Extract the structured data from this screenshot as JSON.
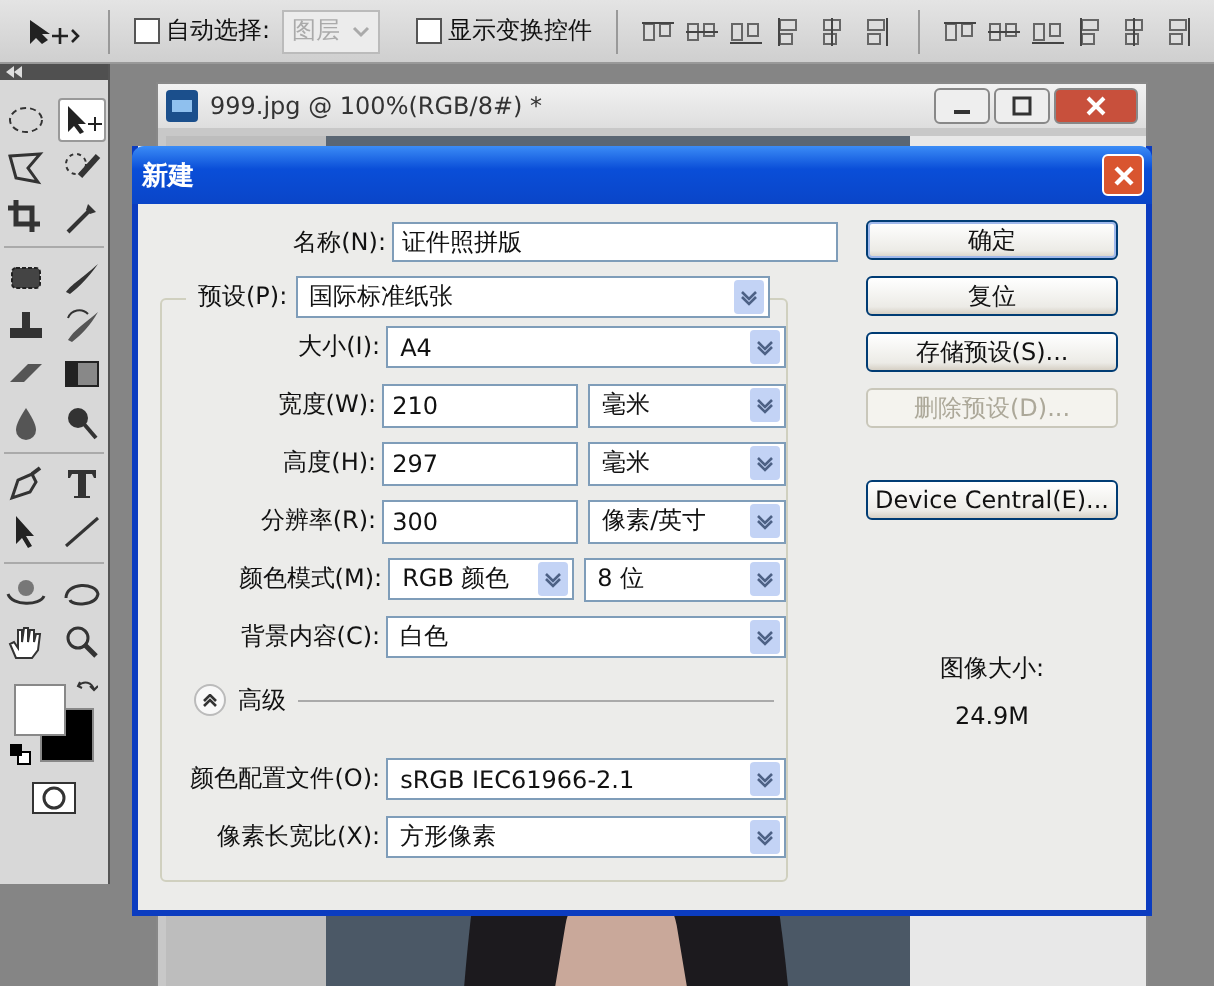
{
  "options_bar": {
    "auto_select": {
      "label": "自动选择:",
      "checked": false
    },
    "layer_select": {
      "value": "图层",
      "disabled": true
    },
    "show_transform": {
      "label": "显示变换控件",
      "checked": false
    }
  },
  "document": {
    "title": "999.jpg @ 100%(RGB/8#) *"
  },
  "dialog": {
    "title": "新建",
    "name": {
      "label": "名称(N):",
      "value": "证件照拼版"
    },
    "preset": {
      "label": "预设(P):",
      "value": "国际标准纸张"
    },
    "fields": [
      {
        "kind": "select",
        "label": "大小(I):",
        "value": "A4"
      },
      {
        "kind": "number_unit",
        "label": "宽度(W):",
        "value": "210",
        "unit": "毫米"
      },
      {
        "kind": "number_unit",
        "label": "高度(H):",
        "value": "297",
        "unit": "毫米"
      },
      {
        "kind": "number_unit",
        "label": "分辨率(R):",
        "value": "300",
        "unit": "像素/英寸"
      },
      {
        "kind": "select_pair",
        "label": "颜色模式(M):",
        "value": "RGB 颜色",
        "unit": "8 位"
      },
      {
        "kind": "select",
        "label": "背景内容(C):",
        "value": "白色"
      }
    ],
    "advanced": {
      "label": "高级",
      "expanded": true
    },
    "advanced_fields": [
      {
        "kind": "select",
        "label": "颜色配置文件(O):",
        "value": "sRGB IEC61966-2.1"
      },
      {
        "kind": "select",
        "label": "像素长宽比(X):",
        "value": "方形像素"
      }
    ],
    "buttons": [
      {
        "label": "确定",
        "default": true,
        "disabled": false
      },
      {
        "label": "复位",
        "default": false,
        "disabled": false
      },
      {
        "label": "存储预设(S)...",
        "default": false,
        "disabled": false
      },
      {
        "label": "删除预设(D)...",
        "default": false,
        "disabled": true
      },
      {
        "label": "Device Central(E)...",
        "default": false,
        "disabled": false
      }
    ],
    "image_size": {
      "label": "图像大小:",
      "value": "24.9M"
    }
  }
}
